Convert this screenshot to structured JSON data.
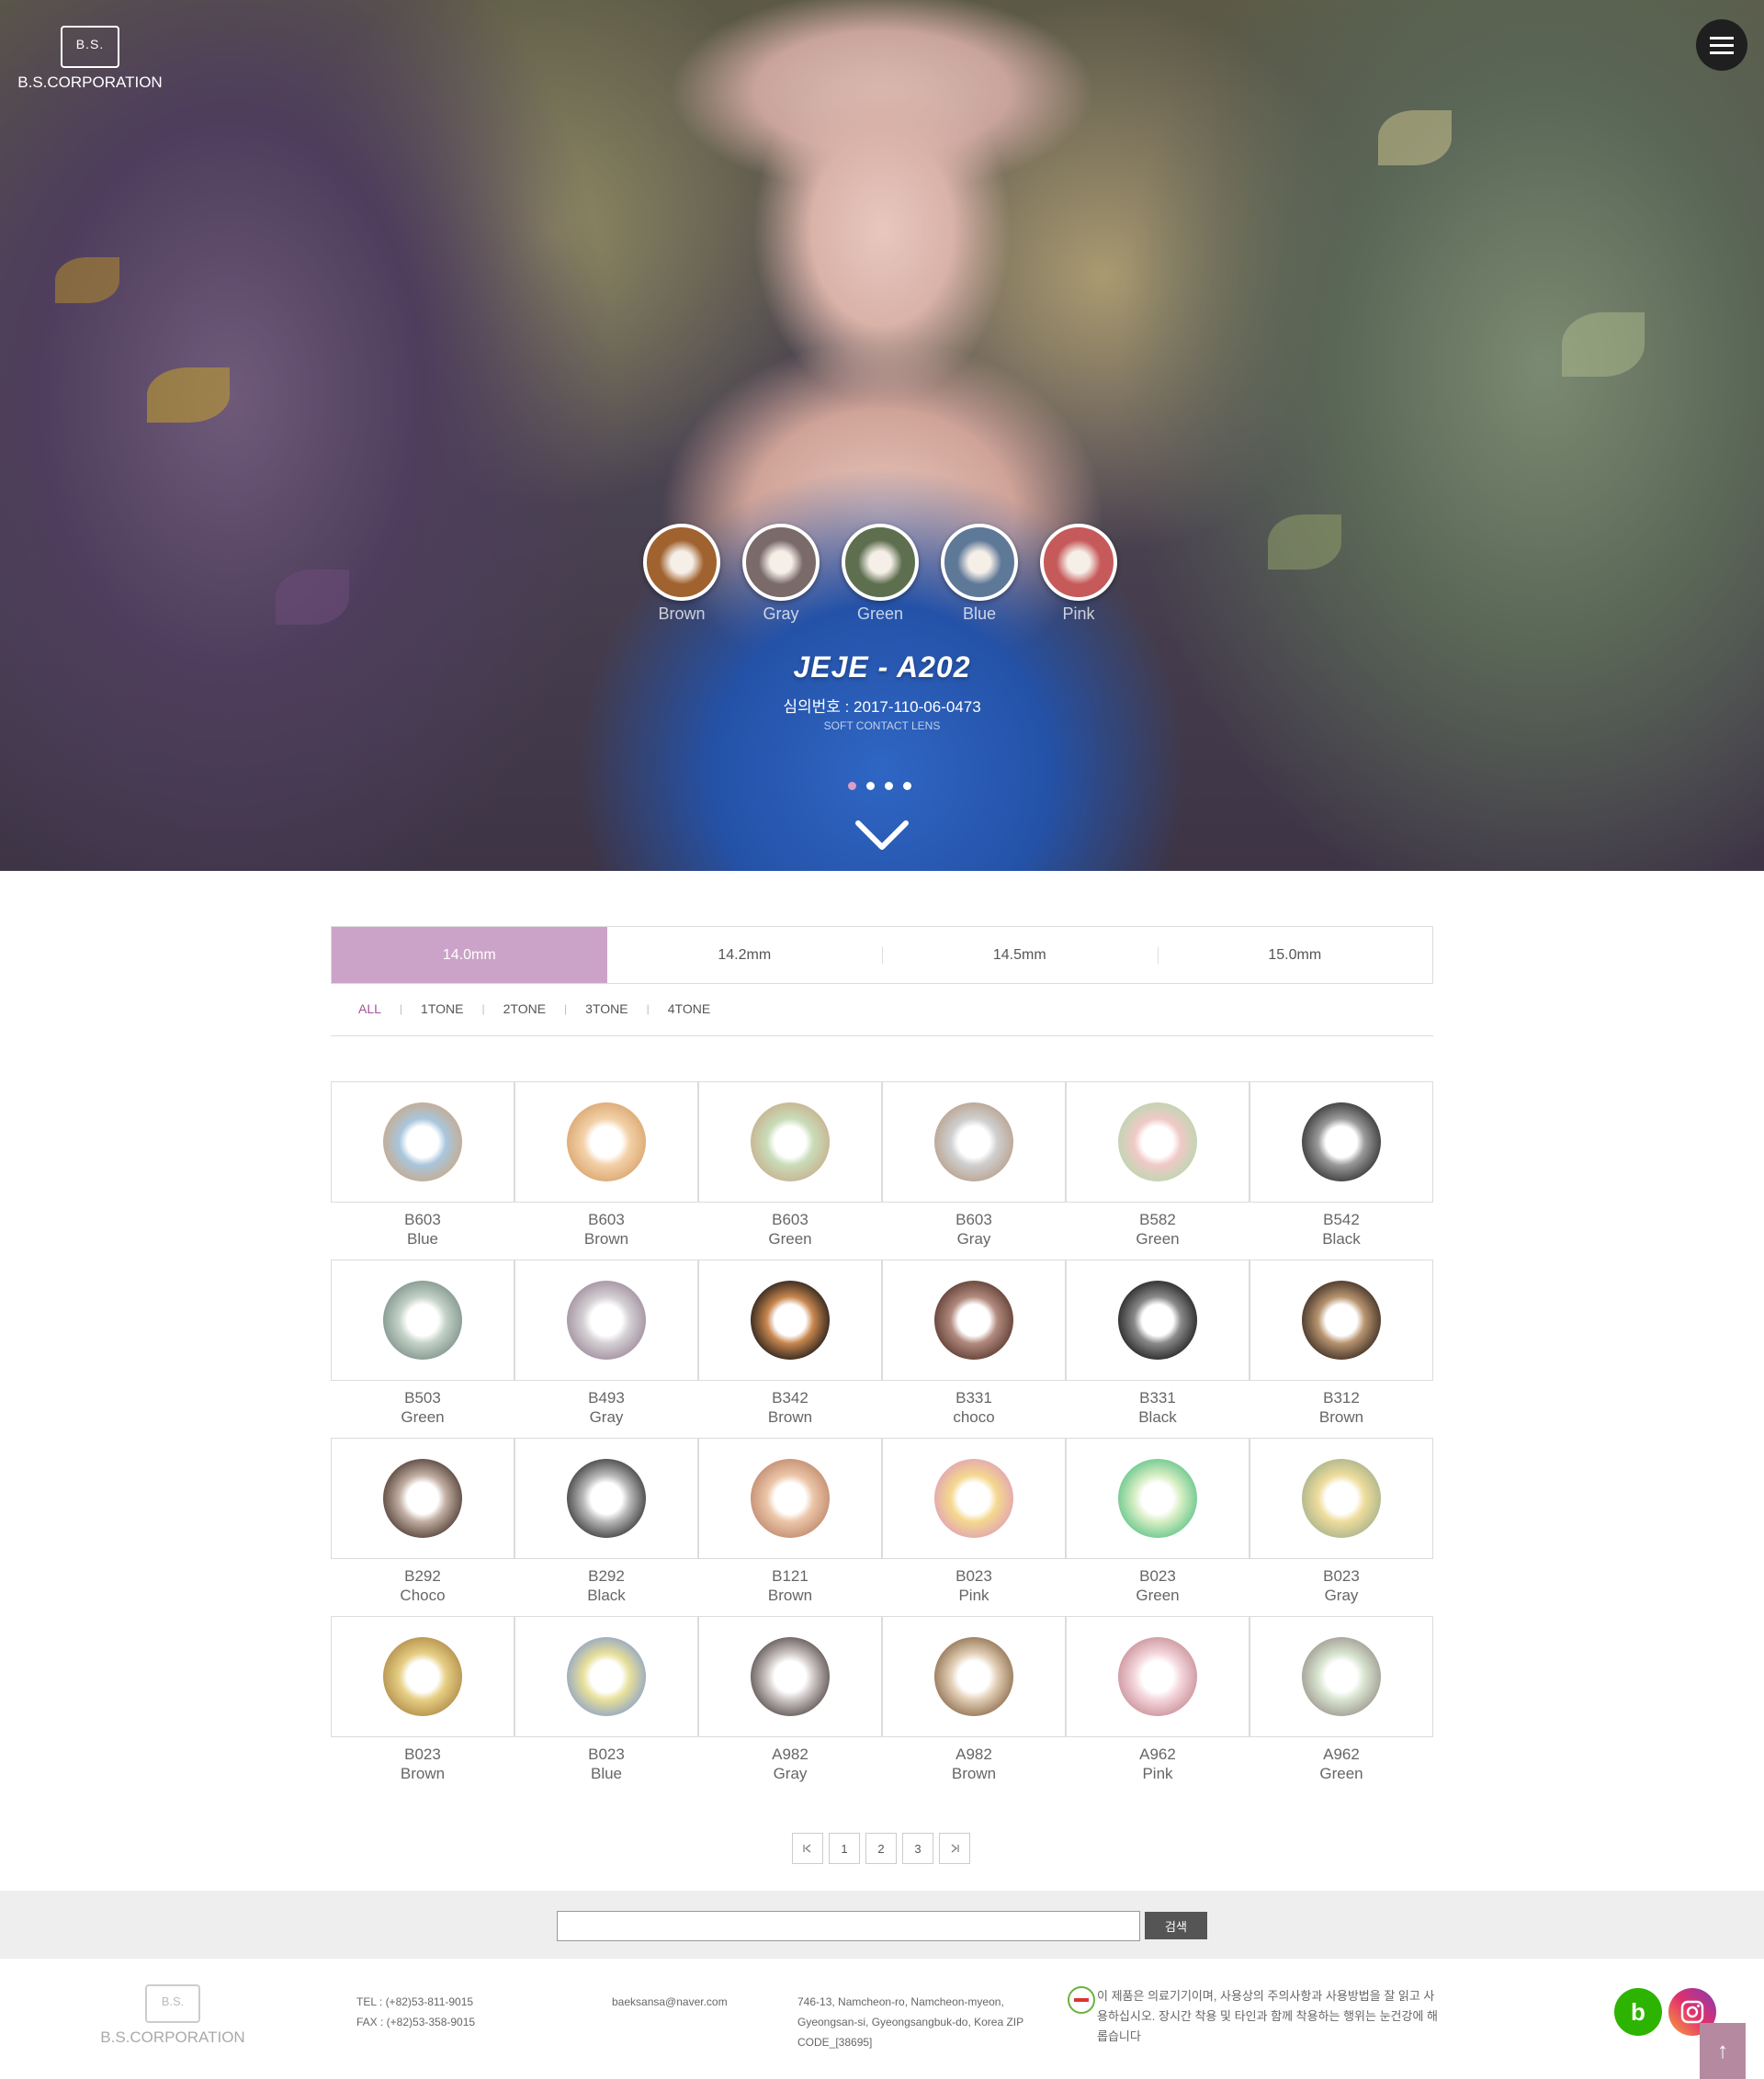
{
  "brand": {
    "mark_text": "B.S.",
    "name": "B.S.CORPORATION"
  },
  "hero": {
    "swatches": [
      {
        "label": "Brown",
        "color": "#a0622e"
      },
      {
        "label": "Gray",
        "color": "#7a6a6a"
      },
      {
        "label": "Green",
        "color": "#5d6f4f"
      },
      {
        "label": "Blue",
        "color": "#5e7898"
      },
      {
        "label": "Pink",
        "color": "#c65a5a"
      }
    ],
    "product_title": "JEJE - A202",
    "approval": "심의번호 : 2017-110-06-0473",
    "product_type": "SOFT CONTACT LENS",
    "slide_count": 4,
    "active_slide": 1
  },
  "size_tabs": [
    {
      "label": "14.0mm",
      "active": true
    },
    {
      "label": "14.2mm",
      "active": false
    },
    {
      "label": "14.5mm",
      "active": false
    },
    {
      "label": "15.0mm",
      "active": false
    }
  ],
  "tone_filters": [
    {
      "label": "ALL",
      "active": true
    },
    {
      "label": "1TONE",
      "active": false
    },
    {
      "label": "2TONE",
      "active": false
    },
    {
      "label": "3TONE",
      "active": false
    },
    {
      "label": "4TONE",
      "active": false
    }
  ],
  "products": [
    {
      "code": "B603",
      "color": "Blue",
      "ring": "#c9a98a",
      "inner": "#a9c6dc"
    },
    {
      "code": "B603",
      "color": "Brown",
      "ring": "#d9a56e",
      "inner": "#f3d1a8"
    },
    {
      "code": "B603",
      "color": "Green",
      "ring": "#c8b08e",
      "inner": "#c9dcb8"
    },
    {
      "code": "B603",
      "color": "Gray",
      "ring": "#b9a08c",
      "inner": "#cfcfcf"
    },
    {
      "code": "B582",
      "color": "Green",
      "ring": "#b8d8b0",
      "inner": "#f0c9c6"
    },
    {
      "code": "B542",
      "color": "Black",
      "ring": "#333333",
      "inner": "#9a9a9a"
    },
    {
      "code": "B503",
      "color": "Green",
      "ring": "#7e928a",
      "inner": "#c4d2c8"
    },
    {
      "code": "B493",
      "color": "Gray",
      "ring": "#9f8c9c",
      "inner": "#d4d0d4"
    },
    {
      "code": "B342",
      "color": "Brown",
      "ring": "#1e1a18",
      "inner": "#c8864e"
    },
    {
      "code": "B331",
      "color": "choco",
      "ring": "#5b3a30",
      "inner": "#b28a7e"
    },
    {
      "code": "B331",
      "color": "Black",
      "ring": "#1f1f1f",
      "inner": "#8a8a8a"
    },
    {
      "code": "B312",
      "color": "Brown",
      "ring": "#3a2a22",
      "inner": "#b8946f"
    },
    {
      "code": "B292",
      "color": "Choco",
      "ring": "#4f3d34",
      "inner": "#c2aea2"
    },
    {
      "code": "B292",
      "color": "Black",
      "ring": "#3a3a3a",
      "inner": "#b9b9b9"
    },
    {
      "code": "B121",
      "color": "Brown",
      "ring": "#c08a6e",
      "inner": "#ecc5a8"
    },
    {
      "code": "B023",
      "color": "Pink",
      "ring": "#e1a2b4",
      "inner": "#f4d88e"
    },
    {
      "code": "B023",
      "color": "Green",
      "ring": "#62c48a",
      "inner": "#d7eec4"
    },
    {
      "code": "B023",
      "color": "Gray",
      "ring": "#a8b28c",
      "inner": "#eedd9c"
    },
    {
      "code": "B023",
      "color": "Brown",
      "ring": "#b08c48",
      "inner": "#e7cf85"
    },
    {
      "code": "B023",
      "color": "Blue",
      "ring": "#8da2c8",
      "inner": "#e8e09a"
    },
    {
      "code": "A982",
      "color": "Gray",
      "ring": "#5a5050",
      "inner": "#cfc8c6"
    },
    {
      "code": "A982",
      "color": "Brown",
      "ring": "#8e6e4e",
      "inner": "#e2cfb6"
    },
    {
      "code": "A962",
      "color": "Pink",
      "ring": "#c99098",
      "inner": "#f4d6dc"
    },
    {
      "code": "A962",
      "color": "Green",
      "ring": "#9e9890",
      "inner": "#d8e4cf"
    }
  ],
  "pagination": {
    "first": "|<",
    "pages": [
      "1",
      "2",
      "3"
    ],
    "last": ">|"
  },
  "search": {
    "placeholder": "",
    "button_label": "검색"
  },
  "footer": {
    "tel": "TEL : (+82)53-811-9015",
    "fax": "FAX : (+82)53-358-9015",
    "email": "baeksansa@naver.com",
    "address_line1": "746-13, Namcheon-ro, Namcheon-myeon,",
    "address_line2": "Gyeongsan-si, Gyeongsangbuk-do, Korea ZIP",
    "address_line3": "CODE_[38695]",
    "notice_line1": "이 제품은 의료기기이며, 사용상의 주의사항과 사용방법을 잘 읽고 사",
    "notice_line2": "용하십시오. 장시간 착용 및 타인과 함께 착용하는 행위는 눈건강에 해",
    "notice_line3": "롭습니다",
    "sns_b": "b",
    "top_icon": "↑"
  },
  "colors": {
    "accent": "#cca3c8",
    "accent_text": "#a6519a",
    "search_button": "#555555"
  }
}
